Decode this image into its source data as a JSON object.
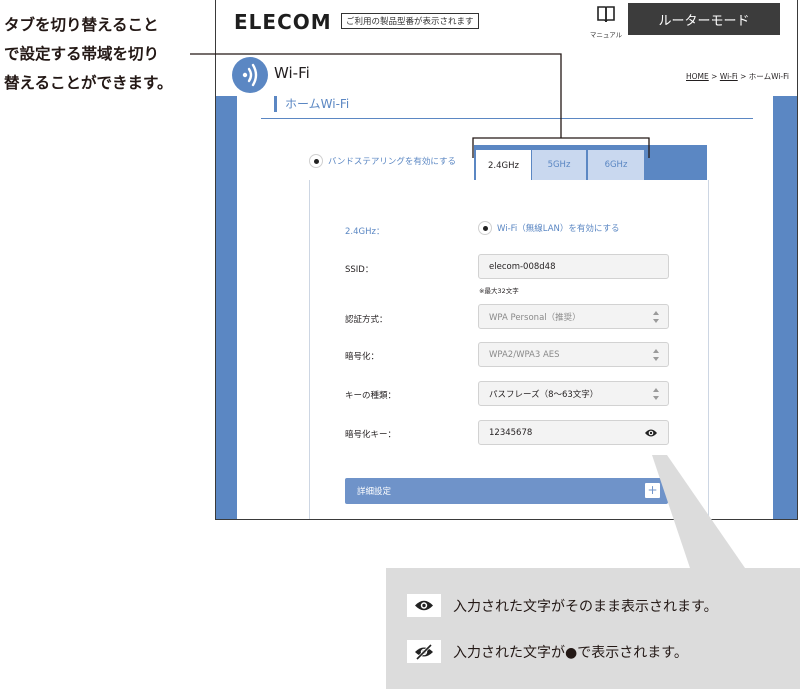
{
  "callout": {
    "line1": "タブを切り替えること",
    "line2": "で設定する帯域を切り",
    "line3": "替えることができます。"
  },
  "header": {
    "logo": "ELECOM",
    "model_notice": "ご利用の製品型番が表示されます",
    "manual_label": "マニュアル",
    "mode_button": "ルーターモード"
  },
  "page": {
    "title": "Wi-Fi",
    "breadcrumb_home": "HOME",
    "breadcrumb_sep1": " > ",
    "breadcrumb_wifi": "Wi-Fi",
    "breadcrumb_sep2": " > ",
    "breadcrumb_current": "ホームWi-Fi",
    "section_title": "ホームWi-Fi"
  },
  "band_steering_label": "バンドステアリングを有効にする",
  "tabs": [
    "2.4GHz",
    "5GHz",
    "6GHz"
  ],
  "form": {
    "band_label": "2.4GHz：",
    "wifi_enable_label": "Wi-Fi（無線LAN）を有効にする",
    "ssid_label": "SSID：",
    "ssid_value": "elecom-008d48",
    "ssid_note": "※最大32文字",
    "auth_label": "認証方式：",
    "auth_value": "WPA Personal（推奨）",
    "encrypt_label": "暗号化：",
    "encrypt_value": "WPA2/WPA3 AES",
    "keytype_label": "キーの種類：",
    "keytype_value": "パスフレーズ（8〜63文字）",
    "key_label": "暗号化キー：",
    "key_value": "12345678",
    "advanced_label": "詳細設定",
    "advanced_plus": "+"
  },
  "info": {
    "show_text": "入力された文字がそのまま表示されます。",
    "hide_text": "入力された文字が●で表示されます。"
  },
  "colors": {
    "accent": "#5b87c3",
    "tab_inactive": "#c9d8ef",
    "mode_button_bg": "#3c3c3c",
    "info_box_bg": "#dcdcdc"
  }
}
